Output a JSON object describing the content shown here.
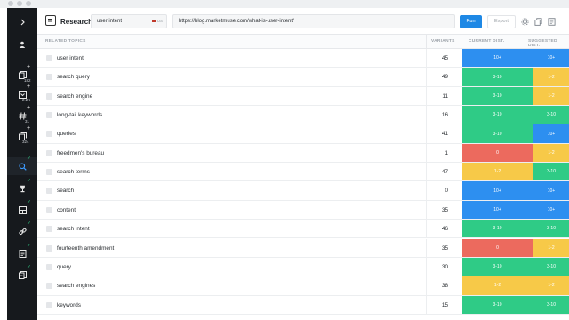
{
  "app": {
    "title": "Research",
    "colors": {
      "sidebar": "#16191d",
      "accent": "#1e88e5",
      "blue": "#2d8ff0",
      "green": "#2fcb86",
      "yellow": "#f7c948",
      "red": "#ec6a5e"
    }
  },
  "topbar": {
    "topic_input_value": "user intent",
    "country": "US",
    "url_input_value": "https://blog.marketmuse.com/what-is-user-intent/",
    "run_label": "Run",
    "export_label": "Export",
    "icons": [
      "gear-icon",
      "copy-icon",
      "list-icon"
    ]
  },
  "sidebar": {
    "items": [
      {
        "icon": "chevron-right-icon"
      },
      {
        "icon": "user-icon"
      },
      {
        "icon": "documents-icon",
        "badge": "182",
        "mark": "+"
      },
      {
        "icon": "inbox-icon",
        "badge": "2.2K",
        "mark": "+"
      },
      {
        "icon": "hashtag-icon",
        "badge": "31",
        "mark": "+"
      },
      {
        "icon": "pages-icon",
        "badge": "324",
        "mark": "+"
      },
      {
        "icon": "research-icon",
        "mark": "✓"
      },
      {
        "icon": "trophy-icon",
        "mark": "✓"
      },
      {
        "icon": "compete-icon",
        "mark": "✓"
      },
      {
        "icon": "link-icon",
        "mark": "✓"
      },
      {
        "icon": "brief-icon",
        "mark": "✓"
      },
      {
        "icon": "optimize-icon",
        "mark": "✓"
      }
    ]
  },
  "table": {
    "headers": {
      "topics": "RELATED TOPICS",
      "variants": "VARIANTS",
      "current": "CURRENT DIST.",
      "suggested": "SUGGESTED DIST."
    },
    "rows": [
      {
        "topic": "user intent",
        "variants": "45",
        "current": "10+",
        "current_color": "blue",
        "suggested": "10+",
        "suggested_color": "blue"
      },
      {
        "topic": "search query",
        "variants": "49",
        "current": "3-10",
        "current_color": "green",
        "suggested": "1-2",
        "suggested_color": "yellow"
      },
      {
        "topic": "search engine",
        "variants": "11",
        "current": "3-10",
        "current_color": "green",
        "suggested": "1-2",
        "suggested_color": "yellow"
      },
      {
        "topic": "long-tail keywords",
        "variants": "16",
        "current": "3-10",
        "current_color": "green",
        "suggested": "3-10",
        "suggested_color": "green"
      },
      {
        "topic": "queries",
        "variants": "41",
        "current": "3-10",
        "current_color": "green",
        "suggested": "10+",
        "suggested_color": "blue"
      },
      {
        "topic": "freedmen's bureau",
        "variants": "1",
        "current": "0",
        "current_color": "red",
        "suggested": "1-2",
        "suggested_color": "yellow"
      },
      {
        "topic": "search terms",
        "variants": "47",
        "current": "1-2",
        "current_color": "yellow",
        "suggested": "3-10",
        "suggested_color": "green"
      },
      {
        "topic": "search",
        "variants": "0",
        "current": "10+",
        "current_color": "blue",
        "suggested": "10+",
        "suggested_color": "blue"
      },
      {
        "topic": "content",
        "variants": "35",
        "current": "10+",
        "current_color": "blue",
        "suggested": "10+",
        "suggested_color": "blue"
      },
      {
        "topic": "search intent",
        "variants": "46",
        "current": "3-10",
        "current_color": "green",
        "suggested": "3-10",
        "suggested_color": "green"
      },
      {
        "topic": "fourteenth amendment",
        "variants": "35",
        "current": "0",
        "current_color": "red",
        "suggested": "1-2",
        "suggested_color": "yellow"
      },
      {
        "topic": "query",
        "variants": "30",
        "current": "3-10",
        "current_color": "green",
        "suggested": "3-10",
        "suggested_color": "green"
      },
      {
        "topic": "search engines",
        "variants": "38",
        "current": "1-2",
        "current_color": "yellow",
        "suggested": "1-2",
        "suggested_color": "yellow"
      },
      {
        "topic": "keywords",
        "variants": "15",
        "current": "3-10",
        "current_color": "green",
        "suggested": "3-10",
        "suggested_color": "green"
      }
    ]
  }
}
